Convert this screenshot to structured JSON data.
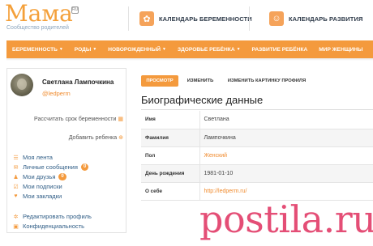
{
  "logo": {
    "text": "Мама",
    "subtitle": "Сообщество родителей",
    "badge": "RU"
  },
  "header": {
    "pregnancy_calendar": "КАЛЕНДАРЬ БЕРЕМЕННОСТИ",
    "development_calendar": "КАЛЕНДАРЬ РАЗВИТИЯ"
  },
  "nav": {
    "items": [
      {
        "label": "БЕРЕМЕННОСТЬ",
        "caret": "▼"
      },
      {
        "label": "РОДЫ",
        "caret": "▼"
      },
      {
        "label": "НОВОРОЖДЕННЫЙ",
        "caret": "▼"
      },
      {
        "label": "ЗДОРОВЬЕ РЕБЁНКА",
        "caret": "▼"
      },
      {
        "label": "РАЗВИТИЕ РЕБЁНКА",
        "caret": ""
      },
      {
        "label": "МИР ЖЕНЩИНЫ",
        "caret": ""
      }
    ]
  },
  "profile": {
    "name": "Светлана Лампочкина",
    "handle": "@ledperm",
    "calc_term": "Рассчитать срок беременности",
    "add_child": "Добавить ребенка"
  },
  "menu": {
    "feed": "Моя лента",
    "messages": "Личные сообщения",
    "messages_count": "0",
    "friends": "Мои друзья",
    "friends_count": "0",
    "subscriptions": "Мои подписки",
    "bookmarks": "Мои закладки",
    "edit_profile": "Редактировать профиль",
    "privacy": "Конфиденциальность"
  },
  "tabs": {
    "view": "ПРОСМОТР",
    "edit": "ИЗМЕНИТЬ",
    "change_picture": "ИЗМЕНИТЬ КАРТИНКУ ПРОФИЛЯ"
  },
  "bio": {
    "title": "Биографические данные",
    "rows": [
      {
        "key": "Имя",
        "value": "Светлана"
      },
      {
        "key": "Фамилия",
        "value": "Лампочкина"
      },
      {
        "key": "Пол",
        "value": "Женский"
      },
      {
        "key": "День рождения",
        "value": "1981-01-10"
      },
      {
        "key": "О себе",
        "value": "http://ledperm.ru/"
      }
    ]
  },
  "watermark": "postila.ru",
  "colors": {
    "accent": "#f49a3d",
    "link": "#2f5d86",
    "watermark": "#e0305f"
  }
}
